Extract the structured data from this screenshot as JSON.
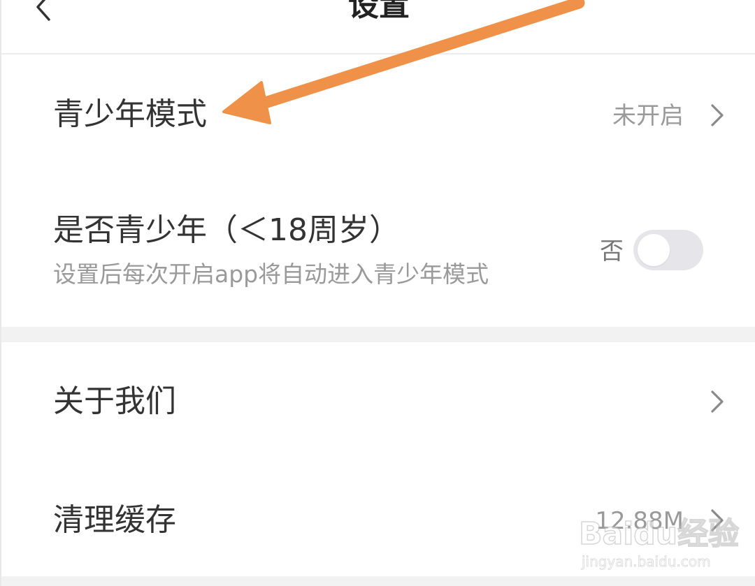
{
  "header": {
    "title": "设置",
    "back_icon": "chevron-left-icon"
  },
  "rows": [
    {
      "label": "青少年模式",
      "value": "未开启",
      "trailing_icon": "chevron-right-icon"
    },
    {
      "label": "是否青少年（＜18周岁）",
      "subtitle": "设置后每次开启app将自动进入青少年模式",
      "toggle_label": "否",
      "toggle_on": false
    },
    {
      "label": "关于我们",
      "trailing_icon": "chevron-right-icon"
    },
    {
      "label": "清理缓存",
      "value": "12.88M",
      "trailing_icon": "chevron-right-icon"
    }
  ],
  "annotation": {
    "arrow_color": "#f0914a"
  },
  "watermark": {
    "logo_text": "Baidu经验",
    "url": "jingyan.baidu.com"
  },
  "colors": {
    "background": "#ffffff",
    "section_gap": "#f2f2f2",
    "toggle_off": "#e6e6ea",
    "text_primary": "#333333",
    "text_secondary": "#9a9a9a"
  }
}
